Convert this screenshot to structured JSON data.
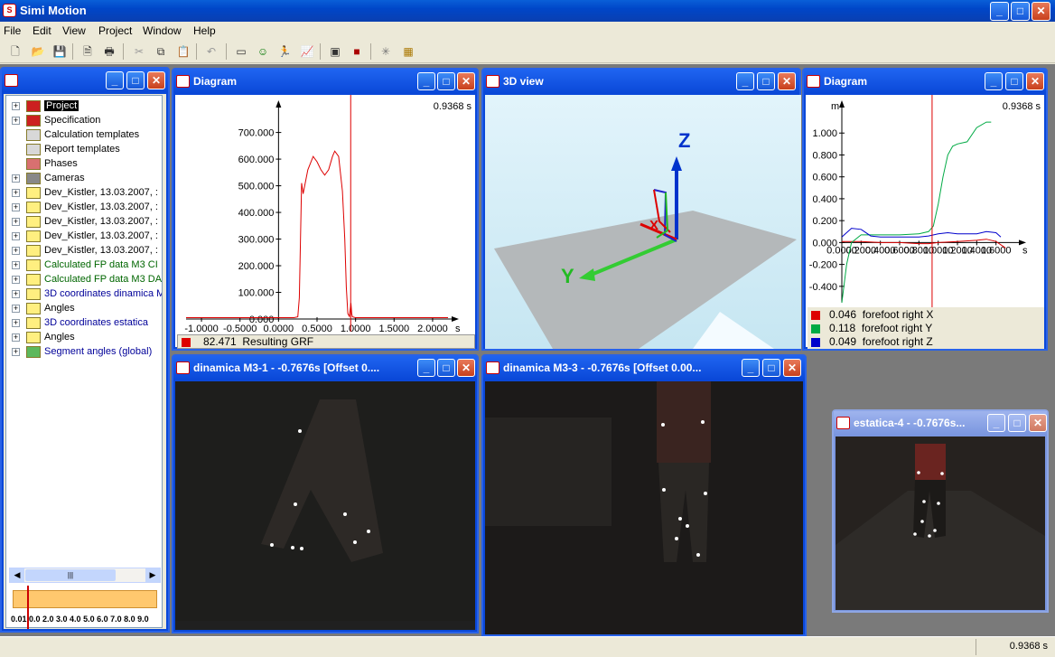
{
  "app": {
    "title": "Simi Motion"
  },
  "menu": [
    "File",
    "Edit",
    "View",
    "Project",
    "Window",
    "Help"
  ],
  "toolbar_icons": [
    "new-icon",
    "open-icon",
    "save-icon",
    "print-preview-icon",
    "print-icon",
    "cut-icon",
    "copy-icon",
    "paste-icon",
    "undo-icon",
    "window-icon",
    "person-icon",
    "runner-icon",
    "chart-icon",
    "video-icon",
    "camera-icon",
    "skeleton-icon",
    "calculator-icon"
  ],
  "project_tree": {
    "items": [
      {
        "label": "Project",
        "selected": true,
        "icon": "book-icon"
      },
      {
        "label": "Specification",
        "icon": "book-icon"
      },
      {
        "label": "Calculation templates",
        "icon": "box-icon"
      },
      {
        "label": "Report templates",
        "icon": "box-icon"
      },
      {
        "label": "Phases",
        "icon": "grid-icon"
      },
      {
        "label": "Cameras",
        "icon": "camera-icon"
      },
      {
        "label": "Dev_Kistler, 13.03.2007, :",
        "icon": "folder-icon"
      },
      {
        "label": "Dev_Kistler, 13.03.2007, :",
        "icon": "folder-icon"
      },
      {
        "label": "Dev_Kistler, 13.03.2007, :",
        "icon": "folder-icon"
      },
      {
        "label": "Dev_Kistler, 13.03.2007, :",
        "icon": "folder-icon"
      },
      {
        "label": "Dev_Kistler, 13.03.2007, :",
        "icon": "folder-icon"
      },
      {
        "label": "Calculated FP data M3 CI",
        "color": "#006600",
        "icon": "folder-icon"
      },
      {
        "label": "Calculated FP data M3 DA",
        "color": "#006600",
        "icon": "folder-icon"
      },
      {
        "label": "3D coordinates dinamica M",
        "color": "#000099",
        "icon": "folder-icon"
      },
      {
        "label": "Angles",
        "icon": "folder-icon"
      },
      {
        "label": "3D coordinates estatica",
        "color": "#000099",
        "icon": "folder-icon"
      },
      {
        "label": "Angles",
        "icon": "folder-icon"
      },
      {
        "label": "Segment angles (global)",
        "color": "#000099",
        "icon": "segment-icon"
      }
    ],
    "timeline_ticks": "0.01 0.0  2.0 3.0 4.0 5.0 6.0 7.0 8.0 9.0",
    "timeline_marker": 0.1
  },
  "diagram_grf": {
    "title": "Diagram",
    "time_readout": "0.9368 s",
    "legend": {
      "value": "82.471",
      "label": "Resulting GRF",
      "color": "#dd0000"
    },
    "chart_data": {
      "type": "line",
      "x_ticks": [
        "-1.0000",
        "-0.5000",
        "0.0000",
        "0.5000",
        "1.0000",
        "1.5000",
        "2.0000"
      ],
      "x_unit": "s",
      "y_ticks": [
        "0.000",
        "100.000",
        "200.000",
        "300.000",
        "400.000",
        "500.000",
        "600.000",
        "700.000"
      ],
      "ylim": [
        0,
        780
      ],
      "xlim": [
        -1.2,
        2.2
      ],
      "cursor_x": 0.9368,
      "series": [
        {
          "name": "Resulting GRF",
          "x": [
            -1.2,
            0.0,
            0.2,
            0.25,
            0.27,
            0.3,
            0.32,
            0.38,
            0.45,
            0.5,
            0.55,
            0.6,
            0.65,
            0.7,
            0.73,
            0.78,
            0.83,
            0.86,
            0.88,
            0.9,
            0.92,
            0.94,
            0.95,
            0.96,
            1.0,
            1.2,
            2.2
          ],
          "values": [
            5,
            5,
            5,
            8,
            80,
            510,
            470,
            560,
            610,
            590,
            560,
            540,
            560,
            610,
            630,
            610,
            480,
            300,
            120,
            20,
            10,
            60,
            20,
            8,
            5,
            5,
            5
          ]
        }
      ]
    }
  },
  "view3d": {
    "title": "3D view",
    "axis_labels": {
      "z": "Z",
      "y": "Y",
      "x": "X"
    }
  },
  "diagram_foot": {
    "title": "Diagram",
    "time_readout": "0.9368 s",
    "y_unit": "m",
    "legend": [
      {
        "value": "0.046",
        "label": "forefoot right X",
        "color": "#dd0000"
      },
      {
        "value": "0.118",
        "label": "forefoot right Y",
        "color": "#00aa44"
      },
      {
        "value": "0.049",
        "label": "forefoot right Z",
        "color": "#0000cc"
      }
    ],
    "chart_data": {
      "type": "line",
      "x_ticks": [
        "0.0000",
        "0.2000",
        "0.4000",
        "0.6000",
        "0.8000",
        "1.0000",
        "1.2000",
        "1.4000",
        "1.6000"
      ],
      "x_unit": "s",
      "y_ticks": [
        "-0.400",
        "-0.200",
        "0.000",
        "0.200",
        "0.400",
        "0.600",
        "0.800",
        "1.000"
      ],
      "ylim": [
        -0.55,
        1.2
      ],
      "xlim": [
        0,
        1.8
      ],
      "cursor_x": 0.9368,
      "series": [
        {
          "name": "forefoot right X",
          "x": [
            0,
            0.2,
            0.4,
            0.6,
            0.8,
            0.9,
            1.0,
            1.2,
            1.4,
            1.5,
            1.6,
            1.7
          ],
          "values": [
            0.01,
            0.01,
            0.0,
            0.0,
            -0.01,
            -0.01,
            0.0,
            0.01,
            0.02,
            0.03,
            0.01,
            -0.05
          ]
        },
        {
          "name": "forefoot right Y",
          "x": [
            0,
            0.05,
            0.1,
            0.2,
            0.4,
            0.6,
            0.8,
            0.9,
            0.95,
            1.0,
            1.05,
            1.1,
            1.15,
            1.2,
            1.3,
            1.4,
            1.5,
            1.55
          ],
          "values": [
            -0.55,
            -0.2,
            0.0,
            0.07,
            0.07,
            0.07,
            0.08,
            0.1,
            0.15,
            0.35,
            0.6,
            0.8,
            0.88,
            0.9,
            0.92,
            1.05,
            1.1,
            1.1
          ]
        },
        {
          "name": "forefoot right Z",
          "x": [
            0,
            0.1,
            0.2,
            0.3,
            0.4,
            0.6,
            0.8,
            0.9,
            1.0,
            1.1,
            1.2,
            1.4,
            1.5,
            1.6,
            1.65
          ],
          "values": [
            0.05,
            0.13,
            0.12,
            0.06,
            0.05,
            0.05,
            0.05,
            0.06,
            0.08,
            0.09,
            0.08,
            0.08,
            0.1,
            0.09,
            0.05
          ]
        }
      ]
    }
  },
  "video1": {
    "title": "dinamica M3-1 - -0.7676s [Offset 0...."
  },
  "video2": {
    "title": "dinamica M3-3 - -0.7676s [Offset 0.00..."
  },
  "video3": {
    "title": "estatica-4 - -0.7676s..."
  },
  "status": {
    "time": "0.9368 s"
  }
}
